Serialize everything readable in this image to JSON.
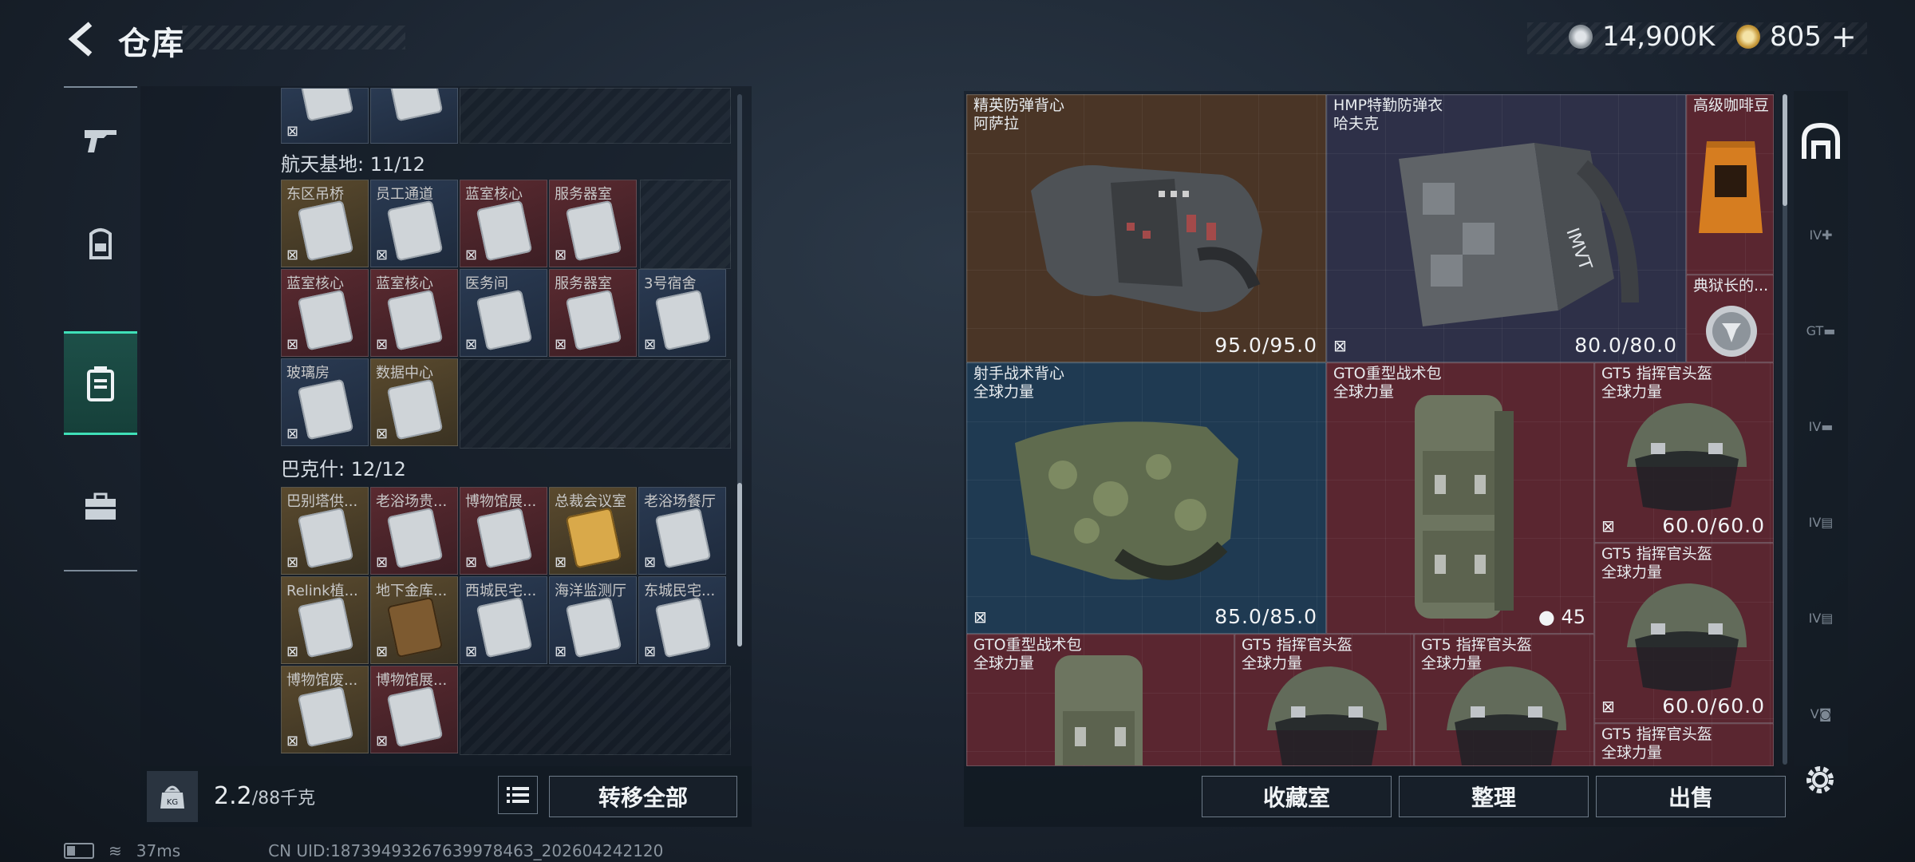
{
  "header": {
    "title": "仓库"
  },
  "currency": {
    "primary": "14,900K",
    "secondary": "805",
    "add": "+"
  },
  "left_nav": {
    "items": [
      {
        "icon": "gun-icon"
      },
      {
        "icon": "backpack-icon"
      },
      {
        "icon": "storage-icon",
        "active": true
      },
      {
        "icon": "briefcase-icon"
      }
    ]
  },
  "left_panel": {
    "groups": [
      {
        "label": "航天基地: 11/12",
        "rows": [
          [
            {
              "name": "东区吊桥",
              "c": "gold"
            },
            {
              "name": "员工通道",
              "c": "blue"
            },
            {
              "name": "蓝室核心",
              "c": "red"
            },
            {
              "name": "服务器室",
              "c": "red"
            }
          ],
          [
            {
              "name": "蓝室核心",
              "c": "red"
            },
            {
              "name": "蓝室核心",
              "c": "red"
            },
            {
              "name": "医务间",
              "c": "blue"
            },
            {
              "name": "服务器室",
              "c": "red"
            },
            {
              "name": "3号宿舍",
              "c": "blue"
            }
          ],
          [
            {
              "name": "玻璃房",
              "c": "blue"
            },
            {
              "name": "数据中心",
              "c": "gold"
            }
          ]
        ]
      },
      {
        "label": "巴克什: 12/12",
        "rows": [
          [
            {
              "name": "巴别塔供...",
              "c": "gold"
            },
            {
              "name": "老浴场贵...",
              "c": "red"
            },
            {
              "name": "博物馆展...",
              "c": "red"
            },
            {
              "name": "总裁会议室",
              "c": "gold",
              "card": "gold"
            },
            {
              "name": "老浴场餐厅",
              "c": "blue"
            }
          ],
          [
            {
              "name": "Relink植...",
              "c": "gold"
            },
            {
              "name": "地下金库...",
              "c": "gold",
              "card": "brown"
            },
            {
              "name": "西城民宅...",
              "c": "blue"
            },
            {
              "name": "海洋监测厅",
              "c": "blue"
            },
            {
              "name": "东城民宅...",
              "c": "blue"
            }
          ],
          [
            {
              "name": "博物馆废...",
              "c": "gold"
            },
            {
              "name": "博物馆展...",
              "c": "red"
            }
          ]
        ]
      }
    ],
    "weight": {
      "current": "2.2",
      "max": "/88千克"
    },
    "transfer_all": "转移全部"
  },
  "right_panel": {
    "items": [
      {
        "id": "vest1",
        "name": "精英防弹背心",
        "sub": "阿萨拉",
        "durability": "95.0/95.0",
        "color": "brown"
      },
      {
        "id": "vest2",
        "name": "HMP特勤防弹衣",
        "sub": "哈夫克",
        "durability": "80.0/80.0",
        "color": "navy"
      },
      {
        "id": "coffee",
        "name": "高级咖啡豆",
        "sub": "",
        "color": "red"
      },
      {
        "id": "medal",
        "name": "典狱长的...",
        "sub": "",
        "color": "red"
      },
      {
        "id": "vest3",
        "name": "射手战术背心",
        "sub": "全球力量",
        "durability": "85.0/85.0",
        "color": "blue"
      },
      {
        "id": "bag1",
        "name": "GTO重型战术包",
        "sub": "全球力量",
        "count": "45",
        "color": "red"
      },
      {
        "id": "helm1",
        "name": "GT5 指挥官头盔",
        "sub": "全球力量",
        "durability": "60.0/60.0",
        "color": "red"
      },
      {
        "id": "helm2",
        "name": "GT5 指挥官头盔",
        "sub": "全球力量",
        "durability": "60.0/60.0",
        "color": "red"
      },
      {
        "id": "bag2",
        "name": "GTO重型战术包",
        "sub": "全球力量",
        "color": "red"
      },
      {
        "id": "helm3",
        "name": "GT5 指挥官头盔",
        "sub": "全球力量",
        "color": "red"
      },
      {
        "id": "helm4",
        "name": "GT5 指挥官头盔",
        "sub": "全球力量",
        "color": "red"
      },
      {
        "id": "helm5",
        "name": "GT5 指挥官头盔",
        "sub": "全球力量",
        "color": "red"
      }
    ],
    "buttons": {
      "collection": "收藏室",
      "sort": "整理",
      "sell": "出售"
    },
    "side_tabs": [
      "IV",
      "GT",
      "IV",
      "IV",
      "IV",
      "V"
    ]
  },
  "status": {
    "ping": "37ms",
    "uid": "CN UID:1873949326763997846З_202604242120"
  }
}
